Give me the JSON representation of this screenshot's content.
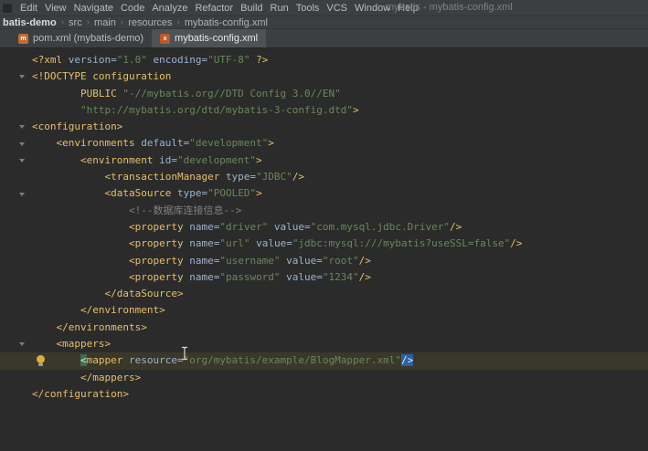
{
  "colors": {
    "menu-bg": "#3c3f41",
    "editor-bg": "#2b2b2b",
    "caret-line-bg": "#3a382a",
    "active-tab-bg": "#4e5254",
    "tag": "#e8bf6a",
    "attr": "#9cb3cd",
    "str": "#6a8759",
    "comment": "#808080",
    "plain": "#a9b7c6",
    "match-bg": "#3e6e4e",
    "sel-bg": "#2961a5"
  },
  "menu_bar": {
    "menus": [
      "Edit",
      "View",
      "Navigate",
      "Code",
      "Analyze",
      "Refactor",
      "Build",
      "Run",
      "Tools",
      "VCS",
      "Window",
      "Help"
    ],
    "window_title": "mybatis - mybatis-config.xml"
  },
  "breadcrumb": {
    "items": [
      "batis-demo",
      "src",
      "main",
      "resources",
      "mybatis-config.xml"
    ],
    "separator": "›"
  },
  "tab_bar": {
    "tabs": [
      {
        "label": "pom.xml (mybatis-demo)",
        "active": false,
        "icon_name": "maven-file-icon",
        "icon_class": "icon-maven",
        "icon_glyph": "m"
      },
      {
        "label": "mybatis-config.xml",
        "active": true,
        "icon_name": "xml-file-icon",
        "icon_class": "icon-xml",
        "icon_glyph": "x"
      }
    ]
  },
  "editor": {
    "lines": [
      {
        "tokens": [
          [
            "g",
            "<?xml "
          ],
          [
            "a",
            "version="
          ],
          [
            "s",
            "\"1.0\""
          ],
          [
            "a",
            " encoding="
          ],
          [
            "s",
            "\"UTF-8\""
          ],
          [
            "g",
            " ?>"
          ]
        ]
      },
      {
        "fold": true,
        "tokens": [
          [
            "g",
            "<!DOCTYPE configuration"
          ]
        ]
      },
      {
        "tokens": [
          [
            "p",
            "        "
          ],
          [
            "g",
            "PUBLIC "
          ],
          [
            "s",
            "\"-//mybatis.org//DTD Config 3.0//EN\""
          ]
        ]
      },
      {
        "tokens": [
          [
            "p",
            "        "
          ],
          [
            "s",
            "\"http://mybatis.org/dtd/mybatis-3-config.dtd\""
          ],
          [
            "g",
            ">"
          ]
        ]
      },
      {
        "fold": true,
        "tokens": [
          [
            "g",
            "<configuration>"
          ]
        ]
      },
      {
        "fold": true,
        "tokens": [
          [
            "p",
            "    "
          ],
          [
            "g",
            "<environments "
          ],
          [
            "a",
            "default="
          ],
          [
            "s",
            "\"development\""
          ],
          [
            "g",
            ">"
          ]
        ]
      },
      {
        "fold": true,
        "tokens": [
          [
            "p",
            "        "
          ],
          [
            "g",
            "<environment "
          ],
          [
            "a",
            "id="
          ],
          [
            "s",
            "\"development\""
          ],
          [
            "g",
            ">"
          ]
        ]
      },
      {
        "tokens": [
          [
            "p",
            "            "
          ],
          [
            "g",
            "<transactionManager "
          ],
          [
            "a",
            "type="
          ],
          [
            "s",
            "\"JDBC\""
          ],
          [
            "g",
            "/>"
          ]
        ]
      },
      {
        "fold": true,
        "tokens": [
          [
            "p",
            "            "
          ],
          [
            "g",
            "<dataSource "
          ],
          [
            "a",
            "type="
          ],
          [
            "s",
            "\"POOLED\""
          ],
          [
            "g",
            ">"
          ]
        ]
      },
      {
        "tokens": [
          [
            "p",
            "                "
          ],
          [
            "c",
            "<!--数据库连接信息-->"
          ]
        ]
      },
      {
        "tokens": [
          [
            "p",
            "                "
          ],
          [
            "g",
            "<property "
          ],
          [
            "a",
            "name="
          ],
          [
            "s",
            "\"driver\""
          ],
          [
            "a",
            " value="
          ],
          [
            "s",
            "\"com.mysql.jdbc.Driver\""
          ],
          [
            "g",
            "/>"
          ]
        ]
      },
      {
        "tokens": [
          [
            "p",
            "                "
          ],
          [
            "g",
            "<property "
          ],
          [
            "a",
            "name="
          ],
          [
            "s",
            "\"url\""
          ],
          [
            "a",
            " value="
          ],
          [
            "s",
            "\"jdbc:mysql:///mybatis?useSSL=false\""
          ],
          [
            "g",
            "/>"
          ]
        ]
      },
      {
        "tokens": [
          [
            "p",
            "                "
          ],
          [
            "g",
            "<property "
          ],
          [
            "a",
            "name="
          ],
          [
            "s",
            "\"username\""
          ],
          [
            "a",
            " value="
          ],
          [
            "s",
            "\"root\""
          ],
          [
            "g",
            "/>"
          ]
        ]
      },
      {
        "tokens": [
          [
            "p",
            "                "
          ],
          [
            "g",
            "<property "
          ],
          [
            "a",
            "name="
          ],
          [
            "s",
            "\"password\""
          ],
          [
            "a",
            " value="
          ],
          [
            "s",
            "\"1234\""
          ],
          [
            "g",
            "/>"
          ]
        ]
      },
      {
        "tokens": [
          [
            "p",
            "            "
          ],
          [
            "g",
            "</dataSource>"
          ]
        ]
      },
      {
        "tokens": [
          [
            "p",
            "        "
          ],
          [
            "g",
            "</environment>"
          ]
        ]
      },
      {
        "tokens": [
          [
            "p",
            "    "
          ],
          [
            "g",
            "</environments>"
          ]
        ]
      },
      {
        "fold": true,
        "tokens": [
          [
            "p",
            "    "
          ],
          [
            "g",
            "<mappers>"
          ]
        ]
      },
      {
        "caret": true,
        "bulb": true,
        "tokens": [
          [
            "p",
            "        "
          ],
          [
            "g",
            "<",
            "match"
          ],
          [
            "g",
            "mapper "
          ],
          [
            "a",
            "resource="
          ],
          [
            "s",
            "\"org/mybatis/example/BlogMapper.xml\""
          ],
          [
            "g",
            "/>",
            "sel"
          ]
        ]
      },
      {
        "tokens": [
          [
            "p",
            "        "
          ],
          [
            "g",
            "</mappers>"
          ]
        ]
      },
      {
        "tokens": [
          [
            "g",
            "</configuration>"
          ]
        ]
      }
    ]
  }
}
